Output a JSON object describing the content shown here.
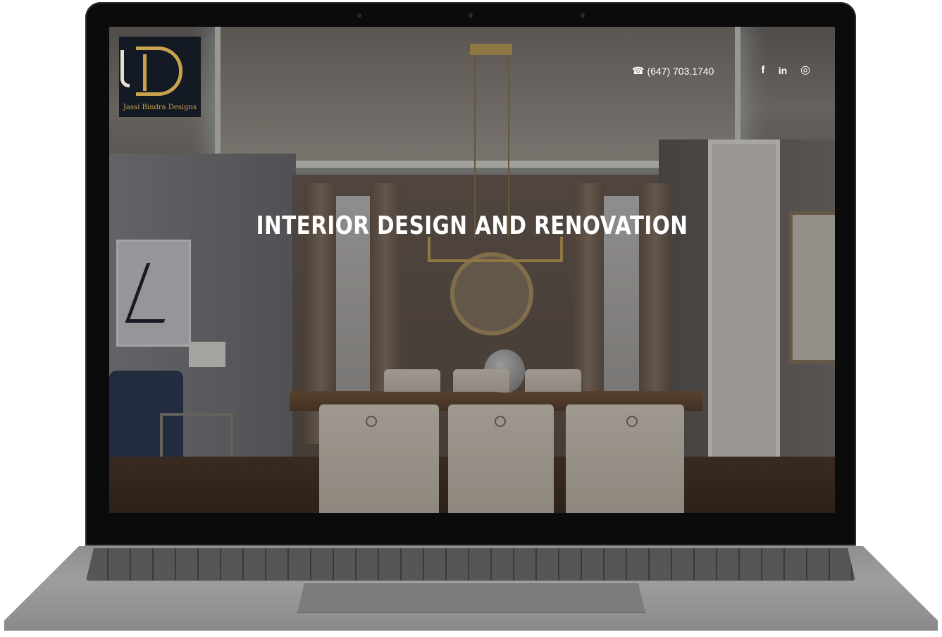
{
  "site": {
    "brand_name": "Jassi Bindra Designs",
    "phone": "(647) 703.1740",
    "hero_title": "INTERIOR DESIGN AND RENOVATION",
    "social": [
      {
        "label": "f",
        "icon": "facebook-icon"
      },
      {
        "label": "in",
        "icon": "linkedin-icon"
      },
      {
        "label": "◎",
        "icon": "instagram-icon"
      }
    ]
  },
  "colors": {
    "logo_gold": "#c9a24e",
    "logo_bg": "#141a24",
    "text_white": "#ffffff"
  }
}
